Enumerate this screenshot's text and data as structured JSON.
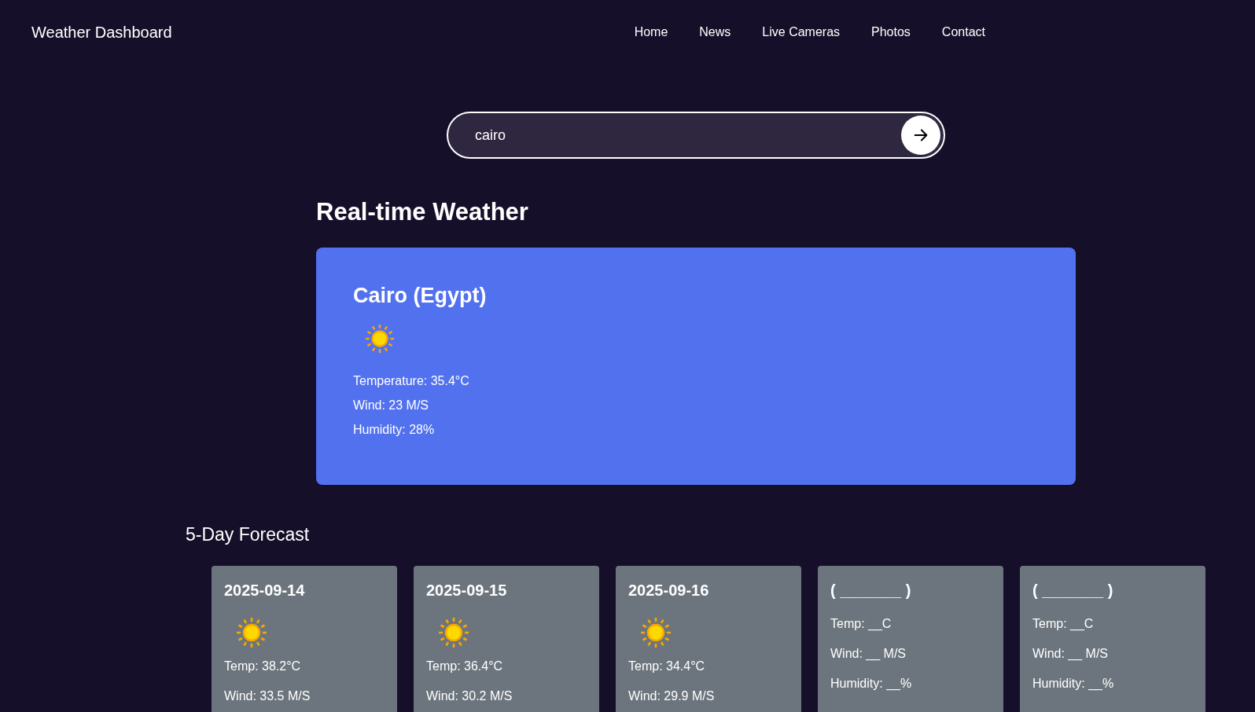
{
  "navbar": {
    "brand": "Weather Dashboard",
    "links": [
      {
        "label": "Home"
      },
      {
        "label": "News"
      },
      {
        "label": "Live Cameras"
      },
      {
        "label": "Photos"
      },
      {
        "label": "Contact"
      }
    ]
  },
  "search": {
    "value": "cairo"
  },
  "current": {
    "heading": "Real-time Weather",
    "city": "Cairo (Egypt)",
    "lines": [
      "Temperature: 35.4°C",
      "Wind: 23 M/S",
      "Humidity: 28%"
    ]
  },
  "forecast": {
    "heading": "5-Day Forecast",
    "days": [
      {
        "kind": "day",
        "title": "2025-09-14",
        "lines": [
          "Temp: 38.2°C",
          "Wind: 33.5 M/S"
        ]
      },
      {
        "kind": "day",
        "title": "2025-09-15",
        "lines": [
          "Temp: 36.4°C",
          "Wind: 30.2 M/S"
        ]
      },
      {
        "kind": "day",
        "title": "2025-09-16",
        "lines": [
          "Temp: 34.4°C",
          "Wind: 29.9 M/S"
        ]
      },
      {
        "kind": "empty",
        "title": "( _______ )",
        "lines": [
          "Temp: __C",
          "Wind: __ M/S",
          "Humidity: __%"
        ]
      },
      {
        "kind": "empty",
        "title": "( _______ )",
        "lines": [
          "Temp: __C",
          "Wind: __ M/S",
          "Humidity: __%"
        ]
      }
    ]
  }
}
